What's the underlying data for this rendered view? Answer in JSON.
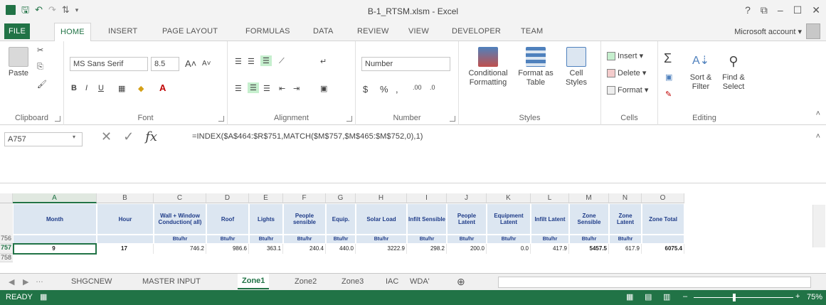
{
  "window": {
    "title": "B-1_RTSM.xlsm - Excel",
    "controls": [
      "?",
      "⧉",
      "–",
      "☐",
      "✕"
    ]
  },
  "ribbon_tabs": [
    "FILE",
    "HOME",
    "INSERT",
    "PAGE LAYOUT",
    "FORMULAS",
    "DATA",
    "REVIEW",
    "VIEW",
    "DEVELOPER",
    "TEAM"
  ],
  "account": "Microsoft account",
  "clipboard": {
    "paste": "Paste",
    "label": "Clipboard"
  },
  "font": {
    "name": "MS Sans Serif",
    "size": "8.5",
    "grow": "A",
    "shrink": "A",
    "bold": "B",
    "italic": "I",
    "underline": "U",
    "label": "Font"
  },
  "alignment": {
    "label": "Alignment"
  },
  "number": {
    "format": "Number",
    "currency": "$",
    "percent": "%",
    "comma": ",",
    "label": "Number"
  },
  "styles": {
    "conditional": "Conditional Formatting",
    "format_table": "Format as Table",
    "cell_styles": "Cell Styles",
    "label": "Styles"
  },
  "cells": {
    "insert": "Insert",
    "delete": "Delete",
    "format": "Format",
    "label": "Cells"
  },
  "editing": {
    "sort": "Sort & Filter",
    "find": "Find & Select",
    "sigma": "Σ",
    "label": "Editing"
  },
  "formula_bar": {
    "name_box": "A757",
    "formula": "=INDEX($A$464:$R$751,MATCH($M$757,$M$465:$M$752,0),1)",
    "fx": "fx",
    "cancel": "✕",
    "enter": "✓"
  },
  "columns": [
    "A",
    "B",
    "C",
    "D",
    "E",
    "F",
    "G",
    "H",
    "I",
    "J",
    "K",
    "L",
    "M",
    "N",
    "O"
  ],
  "rows": [
    "755",
    "756",
    "757",
    "758"
  ],
  "headers": [
    "Month",
    "Hour",
    "Wall + Window Conduction( all)",
    "Roof",
    "Lights",
    "People sensible",
    "Equip.",
    "Solar Load",
    "Infilt Sensible",
    "People Latent",
    "Equipment Latent",
    "Infilt Latent",
    "Zone Sensible",
    "Zone Latent",
    "Zone Total"
  ],
  "units": [
    "",
    "",
    "Btu/hr",
    "Btu/hr",
    "Btu/hr",
    "Btu/hr",
    "Btu/hr",
    "Btu/hr",
    "Btu/hr",
    "Btu/hr",
    "Btu/hr",
    "Btu/hr",
    "Btu/hr",
    "Btu/hr",
    ""
  ],
  "values": [
    "9",
    "17",
    "746.2",
    "986.6",
    "363.1",
    "240.4",
    "440.0",
    "3222.9",
    "298.2",
    "200.0",
    "0.0",
    "417.9",
    "5457.5",
    "617.9",
    "6075.4"
  ],
  "sheet_tabs": [
    "SHGCNEW",
    "MASTER INPUT",
    "Zone1",
    "Zone2",
    "Zone3",
    "IAC",
    "WDA'"
  ],
  "active_sheet": "Zone1",
  "status": {
    "ready": "READY",
    "zoom": "75%"
  }
}
